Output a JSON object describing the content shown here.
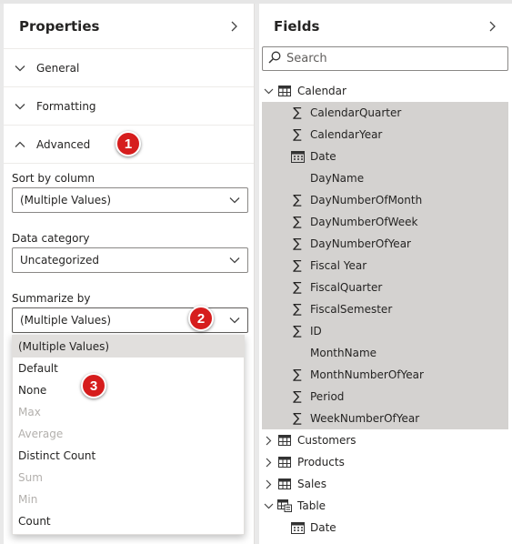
{
  "properties": {
    "title": "Properties",
    "sections": [
      {
        "label": "General",
        "expanded": false
      },
      {
        "label": "Formatting",
        "expanded": false
      },
      {
        "label": "Advanced",
        "expanded": true
      }
    ],
    "sort_by_column": {
      "label": "Sort by column",
      "value": "(Multiple Values)"
    },
    "data_category": {
      "label": "Data category",
      "value": "Uncategorized"
    },
    "summarize_by": {
      "label": "Summarize by",
      "value": "(Multiple Values)",
      "options": [
        {
          "label": "(Multiple Values)",
          "state": "selected"
        },
        {
          "label": "Default",
          "state": "enabled"
        },
        {
          "label": "None",
          "state": "enabled"
        },
        {
          "label": "Max",
          "state": "disabled"
        },
        {
          "label": "Average",
          "state": "disabled"
        },
        {
          "label": "Distinct Count",
          "state": "enabled"
        },
        {
          "label": "Sum",
          "state": "disabled"
        },
        {
          "label": "Min",
          "state": "disabled"
        },
        {
          "label": "Count",
          "state": "enabled"
        }
      ]
    }
  },
  "callouts": [
    "1",
    "2",
    "3"
  ],
  "fields": {
    "title": "Fields",
    "search_placeholder": "Search",
    "tables": [
      {
        "name": "Calendar",
        "expanded": true,
        "fields": [
          {
            "name": "CalendarQuarter",
            "icon": "sigma-icon"
          },
          {
            "name": "CalendarYear",
            "icon": "sigma-icon"
          },
          {
            "name": "Date",
            "icon": "calendar-icon"
          },
          {
            "name": "DayName",
            "icon": "none"
          },
          {
            "name": "DayNumberOfMonth",
            "icon": "sigma-icon"
          },
          {
            "name": "DayNumberOfWeek",
            "icon": "sigma-icon"
          },
          {
            "name": "DayNumberOfYear",
            "icon": "sigma-icon"
          },
          {
            "name": "Fiscal Year",
            "icon": "sigma-icon"
          },
          {
            "name": "FiscalQuarter",
            "icon": "sigma-icon"
          },
          {
            "name": "FiscalSemester",
            "icon": "sigma-icon"
          },
          {
            "name": "ID",
            "icon": "sigma-icon"
          },
          {
            "name": "MonthName",
            "icon": "none"
          },
          {
            "name": "MonthNumberOfYear",
            "icon": "sigma-icon"
          },
          {
            "name": "Period",
            "icon": "sigma-icon"
          },
          {
            "name": "WeekNumberOfYear",
            "icon": "sigma-icon"
          }
        ]
      },
      {
        "name": "Customers",
        "expanded": false,
        "fields": []
      },
      {
        "name": "Products",
        "expanded": false,
        "fields": []
      },
      {
        "name": "Sales",
        "expanded": false,
        "fields": []
      },
      {
        "name": "Table",
        "expanded": true,
        "fields": [
          {
            "name": "Date",
            "icon": "calendar-icon"
          }
        ]
      }
    ]
  },
  "colors": {
    "badge": "#d61d1d",
    "selected_field_bg": "#d4d2d0",
    "disabled_text": "#b3b0ad"
  }
}
